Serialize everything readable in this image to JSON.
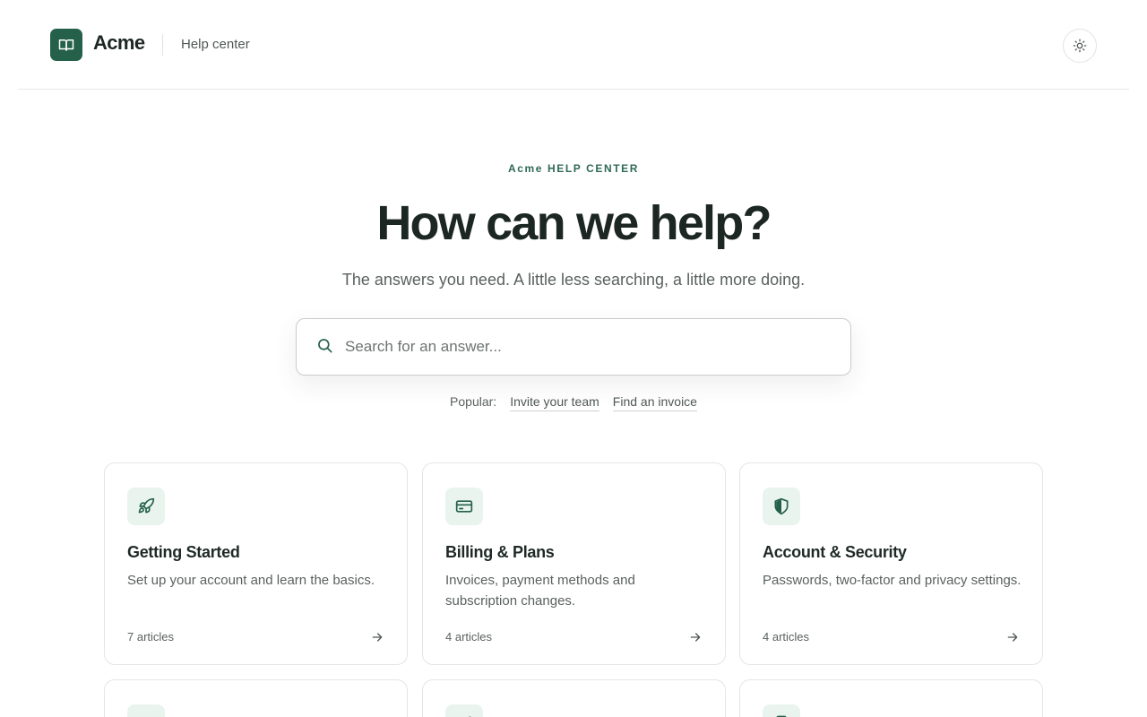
{
  "header": {
    "brand": "Acme",
    "help_link": "Help center",
    "logo_icon": "book-icon",
    "theme_icon": "sun-icon"
  },
  "hero": {
    "eyebrow": "Acme HELP CENTER",
    "title": "How can we help?",
    "subtitle": "The answers you need. A little less searching, a little more doing."
  },
  "search": {
    "icon": "search-icon",
    "placeholder": "Search for an answer...",
    "value": ""
  },
  "popular": {
    "label": "Popular:",
    "links": [
      "Invite your team",
      "Find an invoice"
    ]
  },
  "categories": [
    {
      "icon": "rocket-icon",
      "title": "Getting Started",
      "description": "Set up your account and learn the basics.",
      "count": "7 articles"
    },
    {
      "icon": "credit-card-icon",
      "title": "Billing & Plans",
      "description": "Invoices, payment methods and subscription changes.",
      "count": "4 articles"
    },
    {
      "icon": "shield-icon",
      "title": "Account & Security",
      "description": "Passwords, two-factor and privacy settings.",
      "count": "4 articles"
    }
  ],
  "colors": {
    "accent": "#24604a",
    "accent_soft": "#e9f4ef",
    "text": "#1f2a26",
    "muted": "#5a615e",
    "border": "#e3e6e4"
  }
}
